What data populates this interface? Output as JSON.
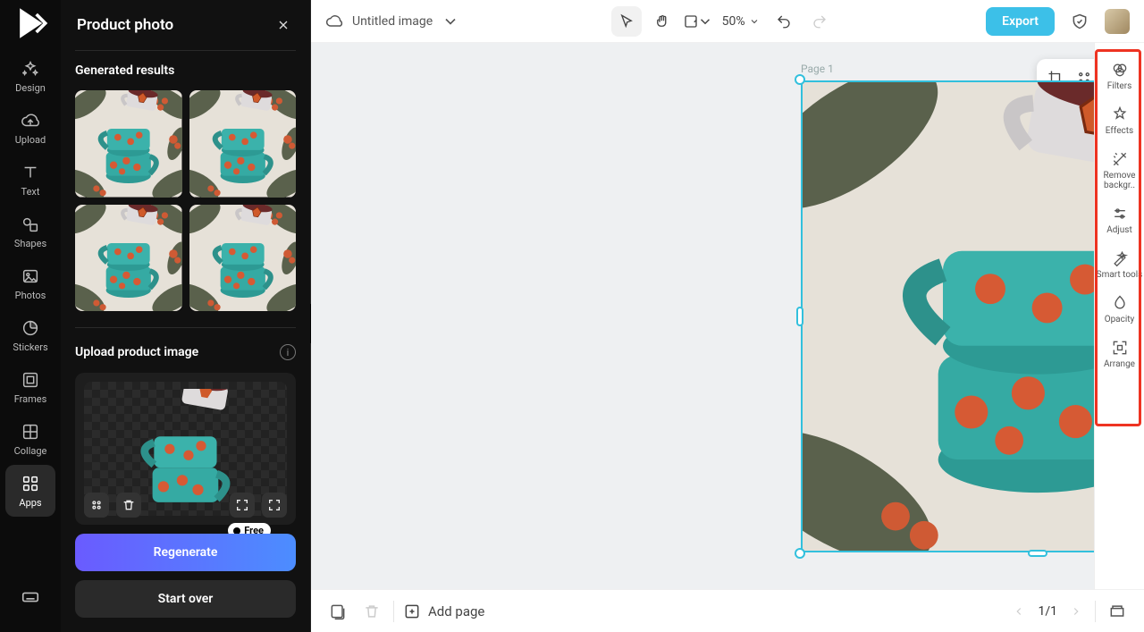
{
  "app": {
    "title": "Product photo"
  },
  "topbar": {
    "doc_title": "Untitled image",
    "zoom": "50%",
    "export": "Export"
  },
  "leftRail": {
    "items": [
      {
        "key": "design",
        "label": "Design",
        "icon": "sparkle"
      },
      {
        "key": "upload",
        "label": "Upload",
        "icon": "cloud-up"
      },
      {
        "key": "text",
        "label": "Text",
        "icon": "text"
      },
      {
        "key": "shapes",
        "label": "Shapes",
        "icon": "shapes"
      },
      {
        "key": "photos",
        "label": "Photos",
        "icon": "image"
      },
      {
        "key": "stickers",
        "label": "Stickers",
        "icon": "sticker"
      },
      {
        "key": "frames",
        "label": "Frames",
        "icon": "frame"
      },
      {
        "key": "collage",
        "label": "Collage",
        "icon": "collage"
      },
      {
        "key": "apps",
        "label": "Apps",
        "icon": "apps",
        "active": true
      }
    ]
  },
  "panel": {
    "generated_title": "Generated results",
    "upload_title": "Upload product image",
    "regenerate": "Regenerate",
    "start_over": "Start over",
    "free_badge": "Free"
  },
  "rightRail": {
    "items": [
      {
        "key": "filters",
        "label": "Filters"
      },
      {
        "key": "effects",
        "label": "Effects"
      },
      {
        "key": "removebg",
        "label": "Remove backgr.."
      },
      {
        "key": "adjust",
        "label": "Adjust"
      },
      {
        "key": "smart",
        "label": "Smart tools"
      },
      {
        "key": "opacity",
        "label": "Opacity"
      },
      {
        "key": "arrange",
        "label": "Arrange"
      }
    ]
  },
  "canvas": {
    "page_label": "Page 1"
  },
  "bottombar": {
    "add_page": "Add page",
    "page_indicator": "1/1"
  }
}
